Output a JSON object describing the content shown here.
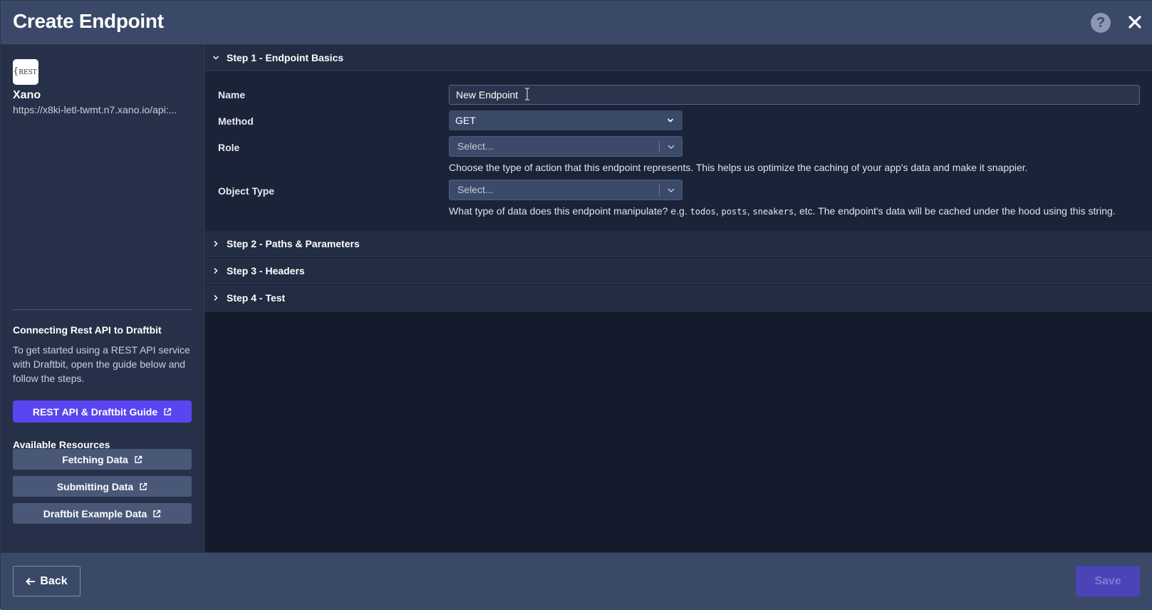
{
  "header": {
    "title": "Create Endpoint",
    "help_label": "?",
    "help_icon": "help-circle-icon",
    "close_icon": "close-icon"
  },
  "sidebar": {
    "logo_text": "REST",
    "provider_name": "Xano",
    "provider_url": "https://x8ki-letl-twmt.n7.xano.io/api:...",
    "guide_title": "Connecting Rest API to Draftbit",
    "guide_text": "To get started using a REST API service with Draftbit, open the guide below and follow the steps.",
    "guide_button_label": "REST API & Draftbit Guide",
    "resources_title": "Available Resources",
    "resources": [
      {
        "label": "Fetching Data"
      },
      {
        "label": "Submitting Data"
      },
      {
        "label": "Draftbit Example Data"
      }
    ],
    "accent_color": "#5a45f2"
  },
  "steps": [
    {
      "label": "Step 1 - Endpoint Basics",
      "expanded": true
    },
    {
      "label": "Step 2 - Paths & Parameters",
      "expanded": false
    },
    {
      "label": "Step 3 - Headers",
      "expanded": false
    },
    {
      "label": "Step 4 - Test",
      "expanded": false
    }
  ],
  "form": {
    "name_label": "Name",
    "name_value": "New Endpoint",
    "method_label": "Method",
    "method_value": "GET",
    "role_label": "Role",
    "role_placeholder": "Select...",
    "role_help": "Choose the type of action that this endpoint represents. This helps us optimize the caching of your app's data and make it snappier.",
    "object_type_label": "Object Type",
    "object_type_placeholder": "Select...",
    "object_help_prefix": "What type of data does this endpoint manipulate? e.g.",
    "object_help_examples": [
      "todos",
      "posts",
      "sneakers"
    ],
    "object_help_suffix": "etc. The endpoint's data will be cached under the hood using this string."
  },
  "footer": {
    "back_label": "Back",
    "save_label": "Save"
  }
}
